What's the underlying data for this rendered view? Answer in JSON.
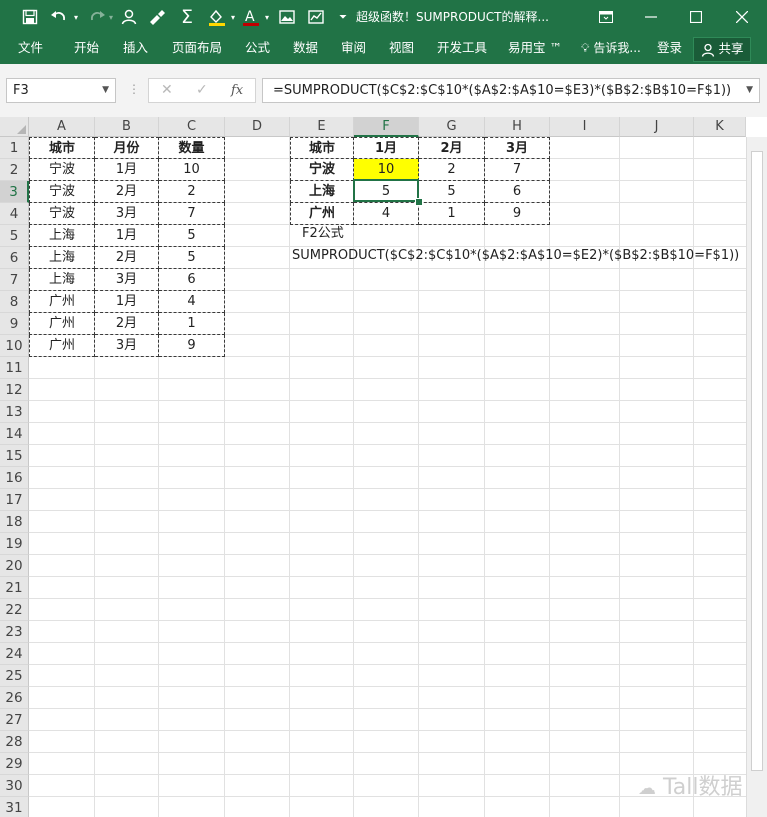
{
  "window": {
    "title": "超级函数！SUMPRODUCT的解释..."
  },
  "quick_access": {
    "font_color_hex": "#c00000",
    "fill_color_hex": "#ffd700"
  },
  "ribbon": {
    "tabs": [
      "文件",
      "开始",
      "插入",
      "页面布局",
      "公式",
      "数据",
      "审阅",
      "视图",
      "开发工具",
      "易用宝 ™"
    ],
    "tell_me": "告诉我...",
    "login": "登录",
    "share": "共享"
  },
  "formula_bar": {
    "name_box": "F3",
    "formula": "=SUMPRODUCT($C$2:$C$10*($A$2:$A$10=$E3)*($B$2:$B$10=F$1))"
  },
  "grid": {
    "columns": [
      "A",
      "B",
      "C",
      "D",
      "E",
      "F",
      "G",
      "H",
      "I",
      "J",
      "K"
    ],
    "selected_column": "F",
    "selected_row": "3",
    "rows": [
      "1",
      "2",
      "3",
      "4",
      "5",
      "6",
      "7",
      "8",
      "9",
      "10",
      "11",
      "12",
      "13",
      "14",
      "15",
      "16",
      "17",
      "18",
      "19",
      "20",
      "21",
      "22",
      "23",
      "24",
      "25",
      "26",
      "27",
      "28",
      "29",
      "30",
      "31"
    ]
  },
  "source_table": {
    "headers": [
      "城市",
      "月份",
      "数量"
    ],
    "rows": [
      [
        "宁波",
        "1月",
        "10"
      ],
      [
        "宁波",
        "2月",
        "2"
      ],
      [
        "宁波",
        "3月",
        "7"
      ],
      [
        "上海",
        "1月",
        "5"
      ],
      [
        "上海",
        "2月",
        "5"
      ],
      [
        "上海",
        "3月",
        "6"
      ],
      [
        "广州",
        "1月",
        "4"
      ],
      [
        "广州",
        "2月",
        "1"
      ],
      [
        "广州",
        "3月",
        "9"
      ]
    ]
  },
  "summary_table": {
    "headers": [
      "城市",
      "1月",
      "2月",
      "3月"
    ],
    "rows": [
      [
        "宁波",
        "10",
        "2",
        "7"
      ],
      [
        "上海",
        "5",
        "5",
        "6"
      ],
      [
        "广州",
        "4",
        "1",
        "9"
      ]
    ],
    "highlight_hex": "#ffff00"
  },
  "notes": {
    "label": "F2公式",
    "formula_text": "SUMPRODUCT($C$2:$C$10*($A$2:$A$10=$E2)*($B$2:$B$10=F$1))"
  },
  "watermark": "Tall数据"
}
